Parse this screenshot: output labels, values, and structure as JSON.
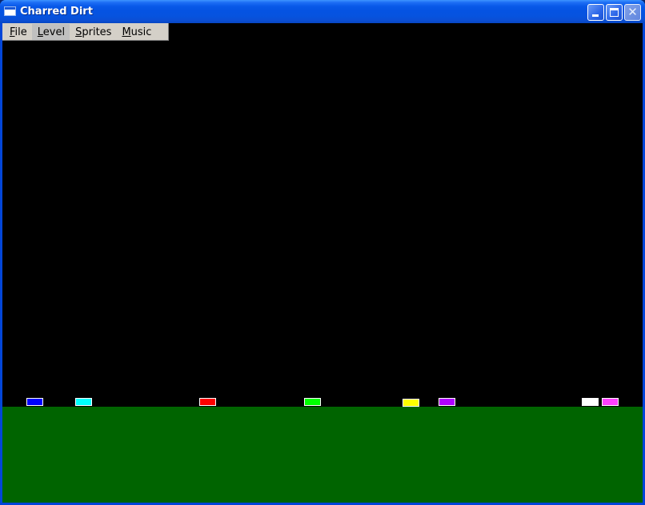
{
  "window": {
    "title": "Charred Dirt"
  },
  "menu": {
    "items": [
      {
        "first": "F",
        "rest": "ile"
      },
      {
        "first": "L",
        "rest": "evel"
      },
      {
        "first": "S",
        "rest": "prites"
      },
      {
        "first": "M",
        "rest": "usic"
      }
    ],
    "active_index": 1
  },
  "colors": {
    "sky": "#000000",
    "ground": "#006400",
    "menu_bg": "#d4d0c8"
  },
  "tanks": [
    {
      "color": "#0000ff"
    },
    {
      "color": "#00ffff"
    },
    {
      "color": "#ff0000"
    },
    {
      "color": "#00ff00"
    },
    {
      "color": "#ffff00"
    },
    {
      "color": "#b000ff"
    },
    {
      "color": "#ffffff"
    },
    {
      "color": "#ff40ff"
    }
  ]
}
